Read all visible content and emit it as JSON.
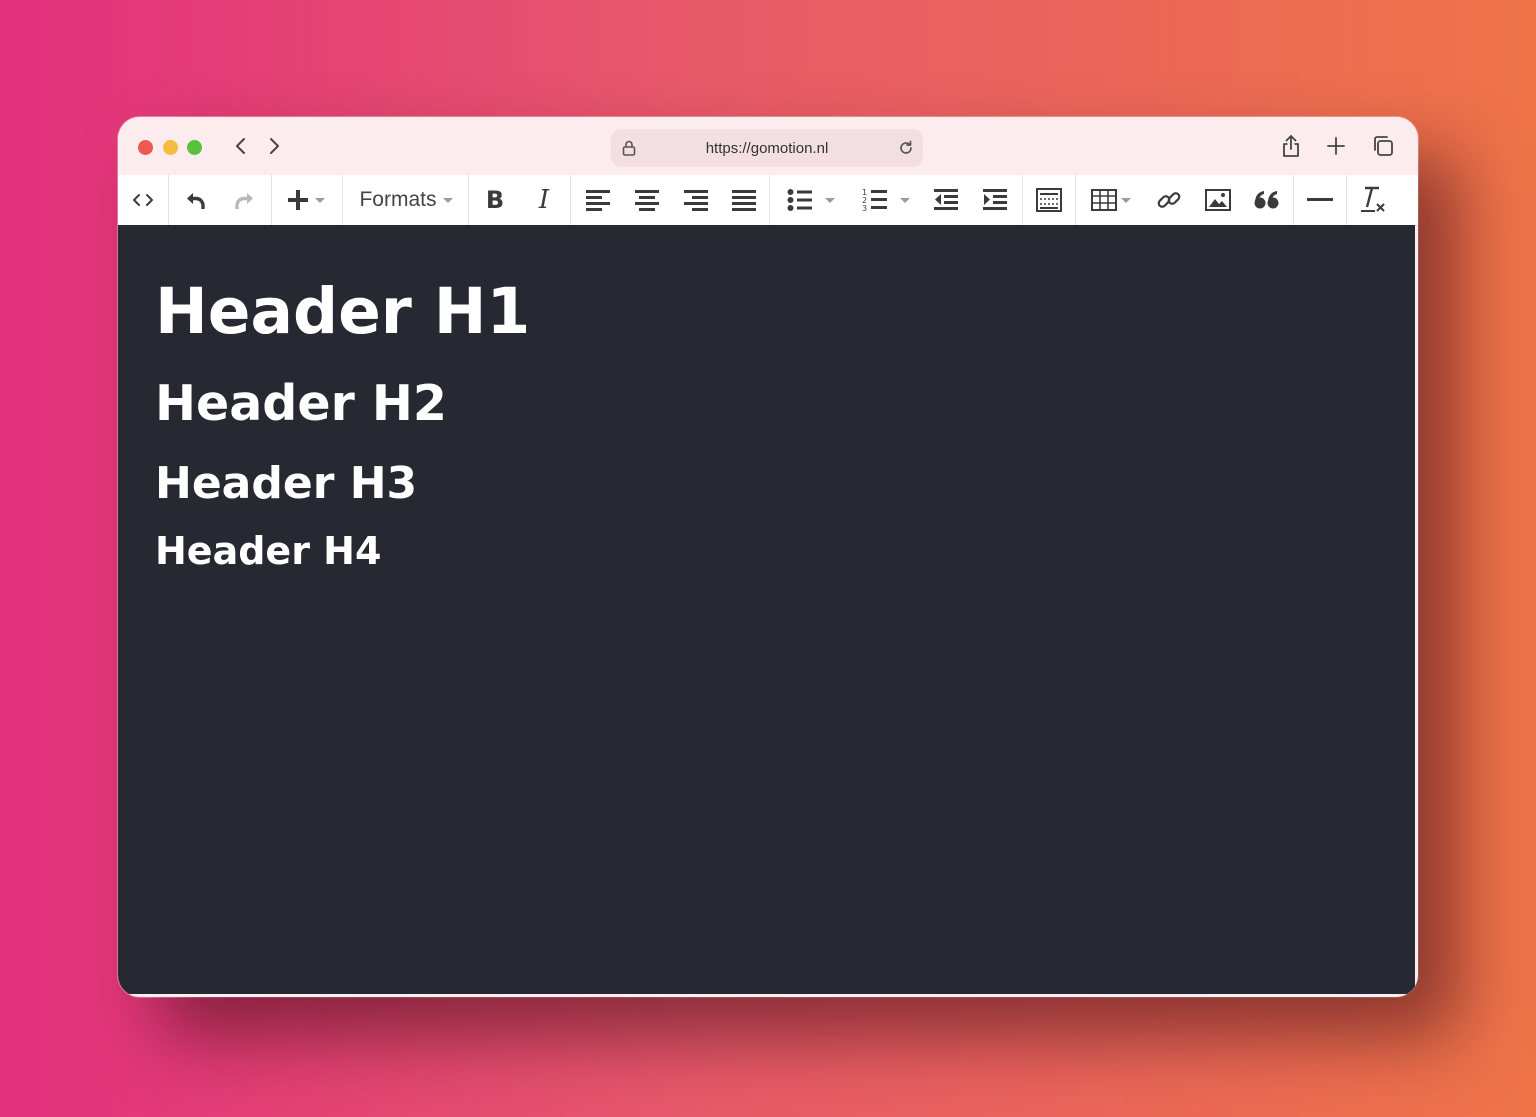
{
  "browser": {
    "url": "https://gomotion.nl"
  },
  "toolbar": {
    "formats_label": "Formats",
    "bold_label": "B",
    "italic_label": "I"
  },
  "document": {
    "h1": "Header H1",
    "h2": "Header H2",
    "h3": "Header H3",
    "h4": "Header H4"
  },
  "colors": {
    "background_gradient_start": "#e2307d",
    "background_gradient_end": "#ee7448",
    "editor_background": "#262931",
    "titlebar": "#fdecee",
    "traffic_red": "#ee5a52",
    "traffic_yellow": "#f3bd3f",
    "traffic_green": "#59c13c"
  }
}
